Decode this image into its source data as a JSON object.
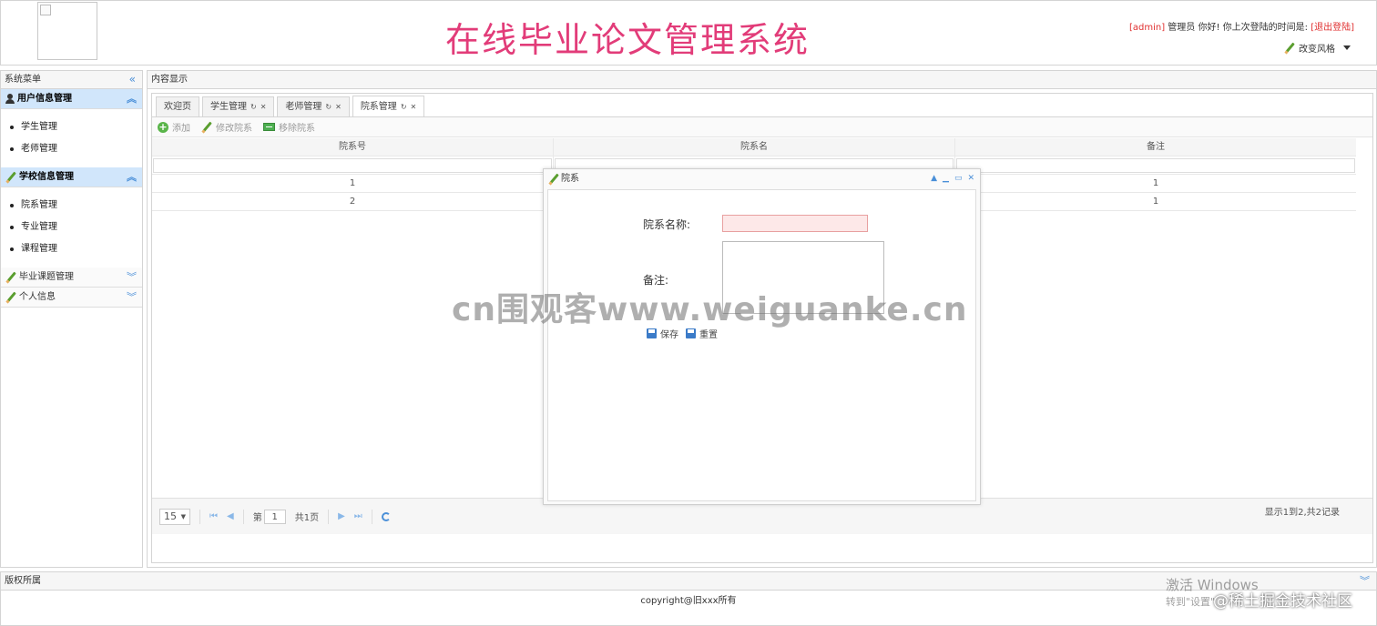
{
  "header": {
    "title": "在线毕业论文管理系统",
    "user": "[admin]",
    "greeting": " 管理员 你好! 你上次登陆的时间是: ",
    "logout": "[退出登陆]",
    "change_theme": "改变风格"
  },
  "sidebar": {
    "title": "系统菜单",
    "groups": [
      {
        "label": "用户信息管理",
        "items": [
          "学生管理",
          "老师管理"
        ]
      },
      {
        "label": "学校信息管理",
        "items": [
          "院系管理",
          "专业管理",
          "课程管理"
        ]
      },
      {
        "label": "毕业课题管理",
        "items": []
      },
      {
        "label": "个人信息",
        "items": []
      }
    ]
  },
  "content": {
    "title": "内容显示",
    "tabs": [
      "欢迎页",
      "学生管理",
      "老师管理",
      "院系管理"
    ],
    "toolbar": {
      "add": "添加",
      "edit": "修改院系",
      "remove": "移除院系"
    },
    "grid": {
      "columns": [
        "院系号",
        "院系名",
        "备注"
      ],
      "rows": [
        [
          "1",
          "",
          "1"
        ],
        [
          "2",
          "",
          "1"
        ]
      ]
    },
    "pager": {
      "page_size": "15",
      "page_prefix": "第",
      "page": "1",
      "page_suffix": "共1页",
      "info": "显示1到2,共2记录"
    }
  },
  "dialog": {
    "title": "院系",
    "name_label": "院系名称:",
    "remark_label": "备注:",
    "save": "保存",
    "reset": "重置"
  },
  "footer": {
    "title": "版权所属",
    "copyright": "copyright@旧xxx所有"
  },
  "overlay": {
    "watermark": "cn围观客www.weiguanke.cn",
    "win_activate": "激活 Windows",
    "win_sub": "转到\"设置\"",
    "juejin": "@稀土掘金技术社区"
  }
}
